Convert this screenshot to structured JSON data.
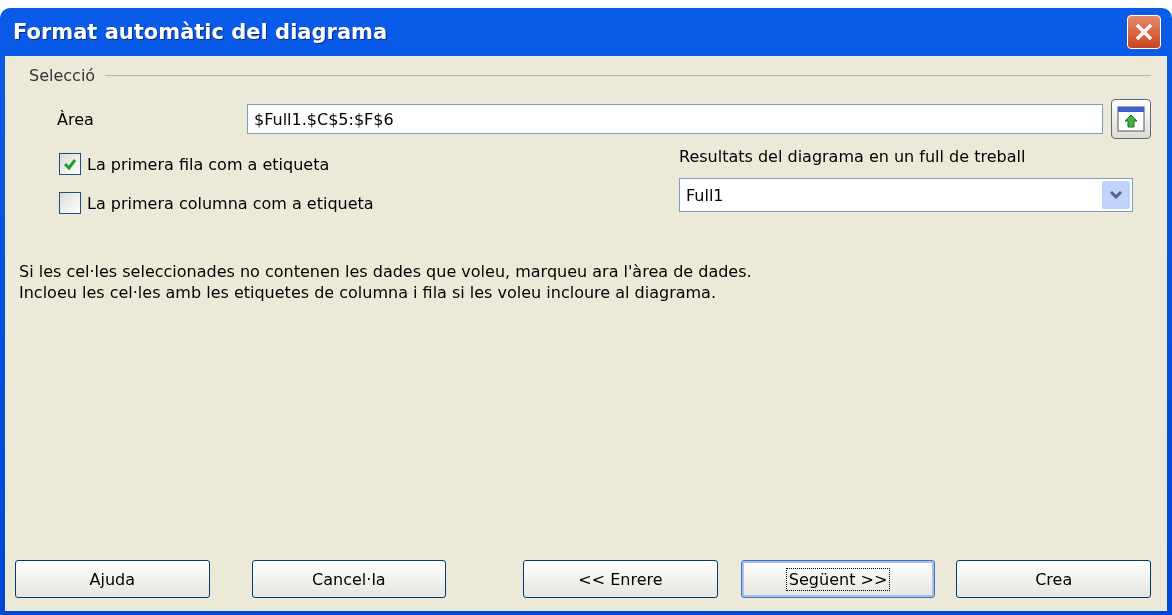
{
  "window": {
    "title": "Format automàtic del diagrama"
  },
  "section": {
    "title": "Selecció"
  },
  "area": {
    "label": "Àrea",
    "value": "$Full1.$C$5:$F$6"
  },
  "checkboxes": [
    {
      "label": "La primera fila com a etiqueta",
      "checked": true
    },
    {
      "label": "La primera columna com a etiqueta",
      "checked": false
    }
  ],
  "target": {
    "label": "Resultats del diagrama en un full de treball",
    "value": "Full1"
  },
  "info": [
    "Si les cel·les seleccionades no contenen les dades que voleu, marqueu ara l'àrea de dades.",
    "Incloeu les cel·les amb les etiquetes de columna i fila si les voleu incloure al diagrama."
  ],
  "buttons": [
    {
      "label": "Ajuda",
      "focused": false
    },
    {
      "label": "Cancel·la",
      "focused": false
    },
    {
      "label": "<< Enrere",
      "focused": false
    },
    {
      "label": "Següent >>",
      "focused": true
    },
    {
      "label": "Crea",
      "focused": false
    }
  ]
}
